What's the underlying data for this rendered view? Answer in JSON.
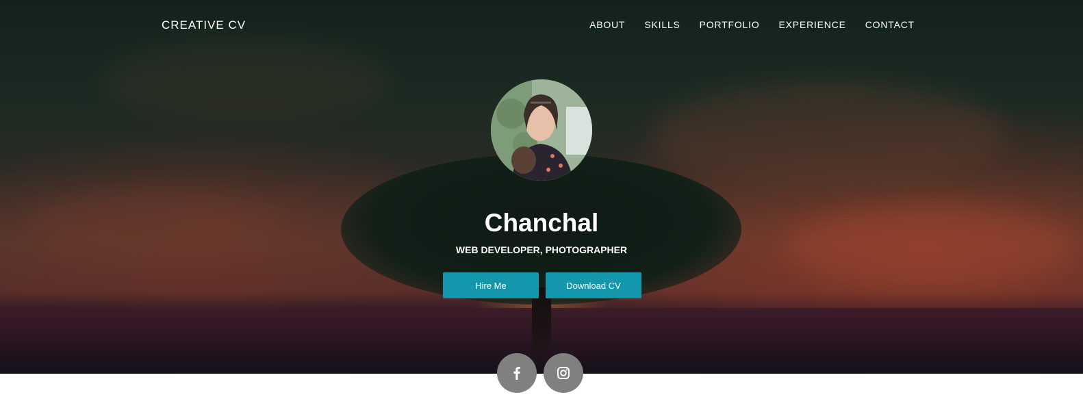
{
  "nav": {
    "brand": "CREATIVE CV",
    "links": [
      {
        "label": "ABOUT"
      },
      {
        "label": "SKILLS"
      },
      {
        "label": "PORTFOLIO"
      },
      {
        "label": "EXPERIENCE"
      },
      {
        "label": "CONTACT"
      }
    ]
  },
  "profile": {
    "name": "Chanchal",
    "title": "WEB DEVELOPER, PHOTOGRAPHER",
    "avatar_icon": "profile-photo"
  },
  "actions": {
    "hire_label": "Hire Me",
    "download_label": "Download CV"
  },
  "social": [
    {
      "icon": "facebook-icon"
    },
    {
      "icon": "instagram-icon"
    }
  ],
  "colors": {
    "accent": "#1496ad",
    "social_bg": "#808080",
    "text": "#ffffff"
  }
}
